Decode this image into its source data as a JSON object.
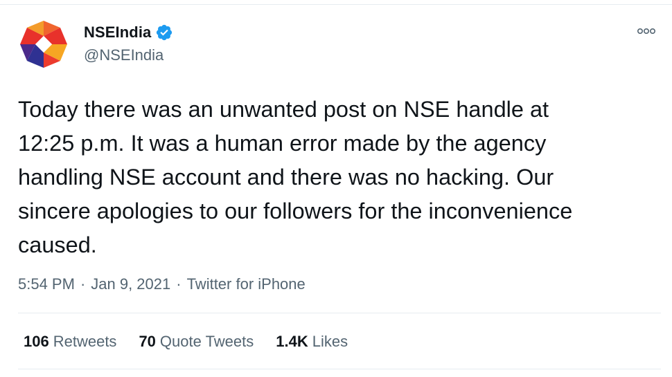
{
  "tweet": {
    "author": {
      "display_name": "NSEIndia",
      "handle": "@NSEIndia",
      "verified": true
    },
    "text": "Today there was an unwanted post on NSE handle at\n12:25 p.m. It was a human error made by the agency\nhandling NSE account and there was no hacking. Our\nsincere apologies to our followers for the inconvenience\ncaused.",
    "meta": {
      "time": "5:54 PM",
      "separator": "·",
      "date": "Jan 9, 2021",
      "source": "Twitter for iPhone"
    },
    "stats": {
      "retweets": {
        "count": "106",
        "label": "Retweets"
      },
      "quote_tweets": {
        "count": "70",
        "label": "Quote Tweets"
      },
      "likes": {
        "count": "1.4K",
        "label": "Likes"
      }
    },
    "icons": {
      "verified": "verified-badge-icon",
      "more": "more-options-icon"
    },
    "colors": {
      "text": "#0f1419",
      "secondary": "#536471",
      "verified": "#1d9bf0",
      "divider": "#e6ecf0"
    }
  }
}
